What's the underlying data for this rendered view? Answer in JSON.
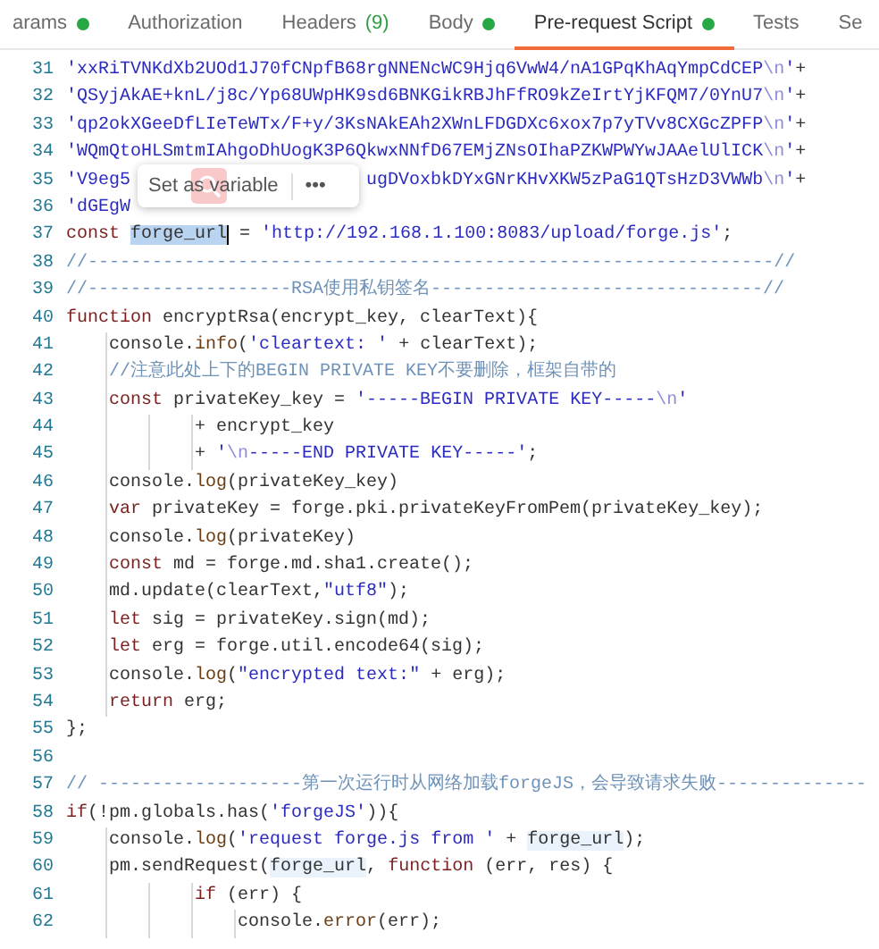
{
  "tabs": [
    {
      "label": "arams",
      "dot": true,
      "selected": false
    },
    {
      "label": "Authorization",
      "dot": false,
      "selected": false
    },
    {
      "label": "Headers",
      "count": "(9)",
      "dot": false,
      "selected": false
    },
    {
      "label": "Body",
      "dot": true,
      "selected": false
    },
    {
      "label": "Pre-request Script",
      "dot": true,
      "selected": true
    },
    {
      "label": "Tests",
      "dot": false,
      "selected": false
    },
    {
      "label": "Se",
      "selected": false
    }
  ],
  "editor": {
    "lines": [
      {
        "number": "31",
        "tokens": [
          {
            "kind": "str",
            "text": "'xxRiTVNKdXb2UOd1J70fCNpfB68rgNNENcWC9Hjq6VwW4/nA1GPqKhAqYmpCdCEP"
          },
          {
            "kind": "esc",
            "text": "\\n"
          },
          {
            "kind": "str",
            "text": "'"
          },
          {
            "kind": "plain",
            "text": "+"
          }
        ]
      },
      {
        "number": "32",
        "tokens": [
          {
            "kind": "str",
            "text": "'QSyjAkAE+knL/j8c/Yp68UWpHK9sd6BNKGikRBJhFfRO9kZeIrtYjKFQM7/0YnU7"
          },
          {
            "kind": "esc",
            "text": "\\n"
          },
          {
            "kind": "str",
            "text": "'"
          },
          {
            "kind": "plain",
            "text": "+"
          }
        ]
      },
      {
        "number": "33",
        "tokens": [
          {
            "kind": "str",
            "text": "'qp2okXGeeDfLIeTeWTx/F+y/3KsNAkEAh2XWnLFDGDXc6xox7p7yTVv8CXGcZPFP"
          },
          {
            "kind": "esc",
            "text": "\\n"
          },
          {
            "kind": "str",
            "text": "'"
          },
          {
            "kind": "plain",
            "text": "+"
          }
        ]
      },
      {
        "number": "34",
        "tokens": [
          {
            "kind": "str",
            "text": "'WQmQtoHLSmtmIAhgoDhUogK3P6QkwxNNfD67EMjZNsOIhaPZKWPWYwJAAelUlICK"
          },
          {
            "kind": "esc",
            "text": "\\n"
          },
          {
            "kind": "str",
            "text": "'"
          },
          {
            "kind": "plain",
            "text": "+"
          }
        ]
      },
      {
        "number": "35",
        "tokens": [
          {
            "kind": "str",
            "text": "'V9eg5"
          },
          {
            "kind": "gap"
          },
          {
            "kind": "str",
            "text": "ugDVoxbkDYxGNrKHvXKW5zPaG1QTsHzD3VWWb"
          },
          {
            "kind": "esc",
            "text": "\\n"
          },
          {
            "kind": "str",
            "text": "'"
          },
          {
            "kind": "plain",
            "text": "+"
          }
        ]
      },
      {
        "number": "36",
        "tokens": [
          {
            "kind": "str",
            "text": "'dGEgW"
          }
        ]
      },
      {
        "number": "37",
        "tokens": [
          {
            "kind": "kw",
            "text": "const "
          },
          {
            "kind": "sel",
            "text": "forge_url"
          },
          {
            "kind": "plain",
            "text": " = "
          },
          {
            "kind": "str",
            "text": "'http://192.168.1.100:8083/upload/forge.js'"
          },
          {
            "kind": "plain",
            "text": ";"
          }
        ]
      },
      {
        "number": "38",
        "tokens": [
          {
            "kind": "com",
            "text": "//----------------------------------------------------------------//"
          }
        ]
      },
      {
        "number": "39",
        "tokens": [
          {
            "kind": "com",
            "text": "//-------------------RSA使用私钥签名-------------------------------//"
          }
        ]
      },
      {
        "number": "40",
        "tokens": [
          {
            "kind": "kw",
            "text": "function"
          },
          {
            "kind": "plain",
            "text": " encryptRsa(encrypt_key, clearText){"
          }
        ]
      },
      {
        "number": "41",
        "tokens": [
          {
            "kind": "plain",
            "text": "    console."
          },
          {
            "kind": "fn",
            "text": "info"
          },
          {
            "kind": "plain",
            "text": "("
          },
          {
            "kind": "str",
            "text": "'cleartext: '"
          },
          {
            "kind": "plain",
            "text": " + clearText);"
          }
        ]
      },
      {
        "number": "42",
        "tokens": [
          {
            "kind": "com",
            "text": "    //注意此处上下的BEGIN PRIVATE KEY不要删除，框架自带的"
          }
        ]
      },
      {
        "number": "43",
        "tokens": [
          {
            "kind": "kw",
            "text": "    const"
          },
          {
            "kind": "plain",
            "text": " privateKey_key = "
          },
          {
            "kind": "str",
            "text": "'-----BEGIN PRIVATE KEY-----"
          },
          {
            "kind": "esc",
            "text": "\\n"
          },
          {
            "kind": "str",
            "text": "'"
          }
        ]
      },
      {
        "number": "44",
        "tokens": [
          {
            "kind": "plain",
            "text": "            + encrypt_key"
          }
        ]
      },
      {
        "number": "45",
        "tokens": [
          {
            "kind": "plain",
            "text": "            + "
          },
          {
            "kind": "str",
            "text": "'"
          },
          {
            "kind": "esc",
            "text": "\\n"
          },
          {
            "kind": "str",
            "text": "-----END PRIVATE KEY-----'"
          },
          {
            "kind": "plain",
            "text": ";"
          }
        ]
      },
      {
        "number": "46",
        "tokens": [
          {
            "kind": "plain",
            "text": "    console."
          },
          {
            "kind": "fn",
            "text": "log"
          },
          {
            "kind": "plain",
            "text": "(privateKey_key)"
          }
        ]
      },
      {
        "number": "47",
        "tokens": [
          {
            "kind": "kw",
            "text": "    var"
          },
          {
            "kind": "plain",
            "text": " privateKey = forge.pki.privateKeyFromPem(privateKey_key);"
          }
        ]
      },
      {
        "number": "48",
        "tokens": [
          {
            "kind": "plain",
            "text": "    console."
          },
          {
            "kind": "fn",
            "text": "log"
          },
          {
            "kind": "plain",
            "text": "(privateKey)"
          }
        ]
      },
      {
        "number": "49",
        "tokens": [
          {
            "kind": "kw",
            "text": "    const"
          },
          {
            "kind": "plain",
            "text": " md = forge.md.sha1.create();"
          }
        ]
      },
      {
        "number": "50",
        "tokens": [
          {
            "kind": "plain",
            "text": "    md.update(clearText,"
          },
          {
            "kind": "str",
            "text": "\"utf8\""
          },
          {
            "kind": "plain",
            "text": ");"
          }
        ]
      },
      {
        "number": "51",
        "tokens": [
          {
            "kind": "kw",
            "text": "    let"
          },
          {
            "kind": "plain",
            "text": " sig = privateKey.sign(md);"
          }
        ]
      },
      {
        "number": "52",
        "tokens": [
          {
            "kind": "kw",
            "text": "    let"
          },
          {
            "kind": "plain",
            "text": " erg = forge.util.encode64(sig);"
          }
        ]
      },
      {
        "number": "53",
        "tokens": [
          {
            "kind": "plain",
            "text": "    console."
          },
          {
            "kind": "fn",
            "text": "log"
          },
          {
            "kind": "plain",
            "text": "("
          },
          {
            "kind": "str",
            "text": "\"encrypted text:\""
          },
          {
            "kind": "plain",
            "text": " + erg);"
          }
        ]
      },
      {
        "number": "54",
        "tokens": [
          {
            "kind": "kw",
            "text": "    return"
          },
          {
            "kind": "plain",
            "text": " erg;"
          }
        ]
      },
      {
        "number": "55",
        "tokens": [
          {
            "kind": "plain",
            "text": "};"
          }
        ]
      },
      {
        "number": "56"
      },
      {
        "number": "57",
        "tokens": [
          {
            "kind": "com",
            "text": "// -------------------第一次运行时从网络加载forgeJS，会导致请求失败--------------"
          }
        ]
      },
      {
        "number": "58",
        "tokens": [
          {
            "kind": "kw",
            "text": "if"
          },
          {
            "kind": "plain",
            "text": "(!pm.globals.has("
          },
          {
            "kind": "str",
            "text": "'forgeJS'"
          },
          {
            "kind": "plain",
            "text": ")){"
          }
        ]
      },
      {
        "number": "59",
        "tokens": [
          {
            "kind": "plain",
            "text": "    console."
          },
          {
            "kind": "fn",
            "text": "log"
          },
          {
            "kind": "plain",
            "text": "("
          },
          {
            "kind": "str",
            "text": "'request forge.js from '"
          },
          {
            "kind": "plain",
            "text": " + "
          },
          {
            "kind": "hl",
            "text": "forge_url"
          },
          {
            "kind": "plain",
            "text": ");"
          }
        ]
      },
      {
        "number": "60",
        "tokens": [
          {
            "kind": "plain",
            "text": "    pm.sendRequest("
          },
          {
            "kind": "hl",
            "text": "forge_url"
          },
          {
            "kind": "plain",
            "text": ", "
          },
          {
            "kind": "kw",
            "text": "function"
          },
          {
            "kind": "plain",
            "text": " (err, res) {"
          }
        ]
      },
      {
        "number": "61",
        "tokens": [
          {
            "kind": "kw",
            "text": "            if"
          },
          {
            "kind": "plain",
            "text": " (err) {"
          }
        ]
      },
      {
        "number": "62",
        "tokens": [
          {
            "kind": "plain",
            "text": "                console."
          },
          {
            "kind": "fn",
            "text": "error"
          },
          {
            "kind": "plain",
            "text": "(err);"
          }
        ]
      }
    ]
  },
  "popup": {
    "label": "Set as variable",
    "more": "•••"
  }
}
